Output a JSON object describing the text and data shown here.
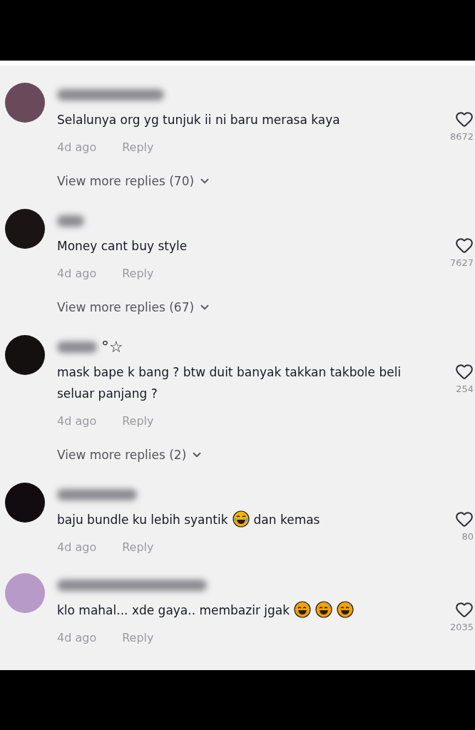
{
  "comments": [
    {
      "color": "#6a4a5a",
      "parts": [
        {
          "kind": "text",
          "text": "Selalunya org yg tunjuk ii ni baru merasa kaya"
        }
      ],
      "time": "4d ago",
      "reply": "Reply",
      "likes": "8672",
      "view_more": "View more replies (70)"
    },
    {
      "color": "#1a1414",
      "parts": [
        {
          "kind": "text",
          "text": "Money cant buy style"
        }
      ],
      "time": "4d ago",
      "reply": "Reply",
      "likes": "7627",
      "view_more": "View more replies (67)"
    },
    {
      "color": "#141010",
      "name_suffix": "°☆",
      "parts": [
        {
          "kind": "text",
          "text": "mask bape k bang ? btw duit banyak takkan takbole beli seluar panjang ?"
        }
      ],
      "time": "4d ago",
      "reply": "Reply",
      "likes": "254",
      "view_more": "View more replies (2)"
    },
    {
      "color": "#120c10",
      "parts": [
        {
          "kind": "text",
          "text": "baju bundle ku lebih syantik"
        },
        {
          "kind": "laughing_tears_emoji"
        },
        {
          "kind": "text",
          "text": "dan kemas"
        }
      ],
      "time": "4d ago",
      "reply": "Reply",
      "likes": "80"
    },
    {
      "color": "#b89ac8",
      "parts": [
        {
          "kind": "text",
          "text": "klo mahal... xde gaya.. membazir jgak"
        },
        {
          "kind": "grinning_sweat_emoji"
        },
        {
          "kind": "grinning_sweat_emoji"
        },
        {
          "kind": "grinning_sweat_emoji"
        }
      ],
      "time": "4d ago",
      "reply": "Reply",
      "likes": "2035"
    }
  ]
}
